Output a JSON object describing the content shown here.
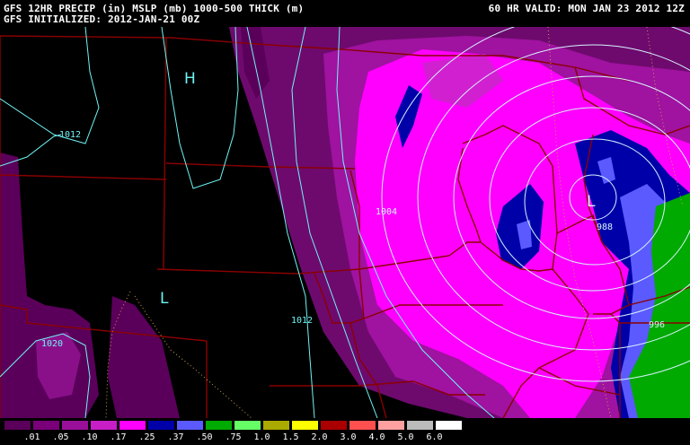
{
  "header": {
    "title_line": "GFS 12HR PRECIP (in) MSLP (mb) 1000-500 THICK (m)",
    "init_line": "GFS INITIALIZED: 2012-JAN-21 00Z",
    "valid_line": "60 HR VALID: MON JAN 23 2012 12Z"
  },
  "map": {
    "pressure_labels": [
      "1012",
      "1004",
      "988",
      "1012",
      "996",
      "1020"
    ],
    "pressure_centers": [
      "H",
      "L",
      "L"
    ],
    "colors": {
      "isobar": "#6ff4f4",
      "inner_isobar": "#d8f4ff",
      "state_border": "#8b0000",
      "thickness": "#c8a050"
    }
  },
  "legend": {
    "items": [
      {
        "label": ".01",
        "color": "#5a005a"
      },
      {
        "label": ".05",
        "color": "#7a007a"
      },
      {
        "label": ".10",
        "color": "#9a0f9a"
      },
      {
        "label": ".17",
        "color": "#c81ec8"
      },
      {
        "label": ".25",
        "color": "#ff00ff"
      },
      {
        "label": ".37",
        "color": "#0000a8"
      },
      {
        "label": ".50",
        "color": "#5a5aff"
      },
      {
        "label": ".75",
        "color": "#00aa00"
      },
      {
        "label": "1.0",
        "color": "#66ff66"
      },
      {
        "label": "1.5",
        "color": "#aaaa00"
      },
      {
        "label": "2.0",
        "color": "#ffff00"
      },
      {
        "label": "3.0",
        "color": "#aa0000"
      },
      {
        "label": "4.0",
        "color": "#ff5050"
      },
      {
        "label": "5.0",
        "color": "#ffa0a0"
      },
      {
        "label": "6.0",
        "color": "#bbbbbb"
      },
      {
        "label": "",
        "color": "#ffffff"
      }
    ]
  }
}
